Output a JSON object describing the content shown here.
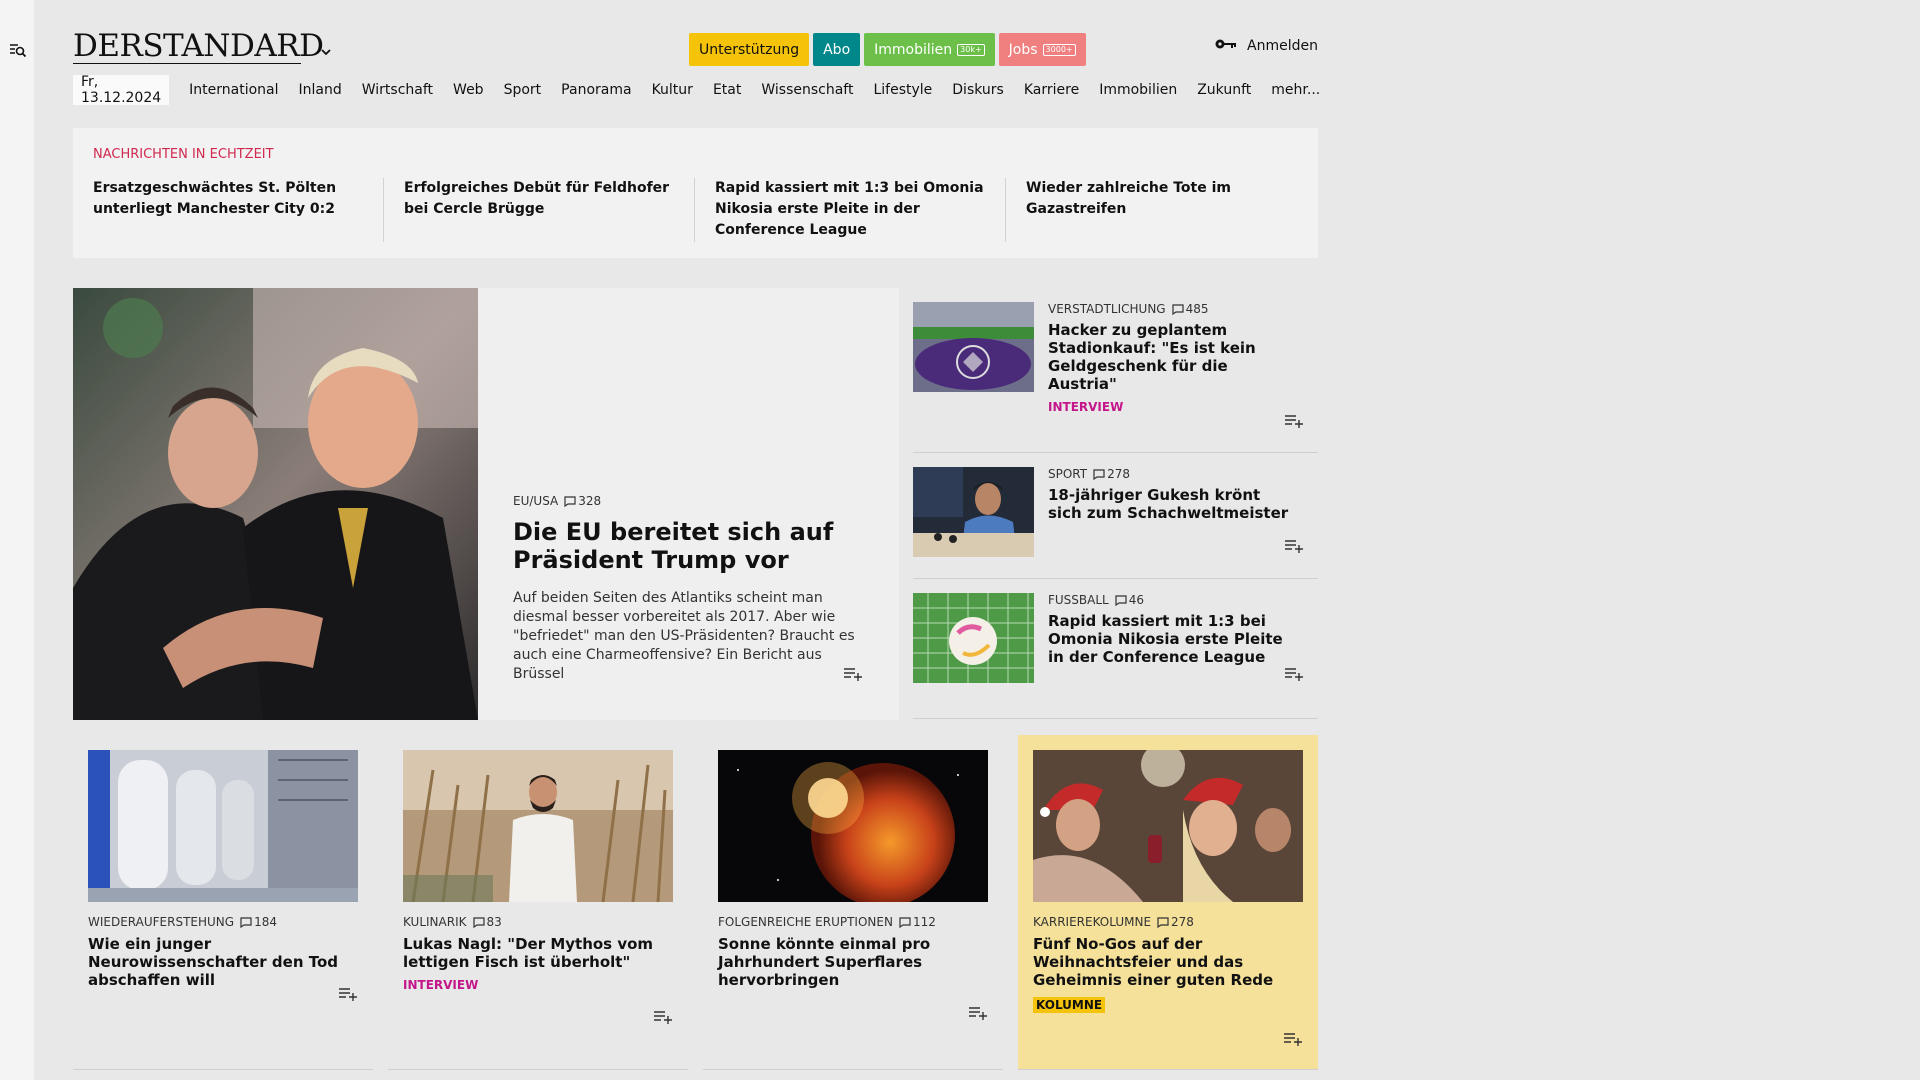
{
  "header": {
    "logo_text": "DERSTANDARD",
    "promo": [
      {
        "label": "Unterstützung",
        "badge": "",
        "bg": "#f5c40a",
        "fg": "#111111"
      },
      {
        "label": "Abo",
        "badge": "",
        "bg": "#00878a",
        "fg": "#ffffff"
      },
      {
        "label": "Immobilien",
        "badge": "30k+",
        "bg": "#6cc04a",
        "fg": "#ffffff"
      },
      {
        "label": "Jobs",
        "badge": "3000+",
        "bg": "#f08080",
        "fg": "#ffffff"
      }
    ],
    "login_label": "Anmelden"
  },
  "nav": {
    "date": "Fr, 13.12.2024",
    "items": [
      "International",
      "Inland",
      "Wirtschaft",
      "Web",
      "Sport",
      "Panorama",
      "Kultur",
      "Etat",
      "Wissenschaft",
      "Lifestyle",
      "Diskurs",
      "Karriere",
      "Immobilien",
      "Zukunft",
      "mehr..."
    ]
  },
  "ticker": {
    "label": "NACHRICHTEN IN ECHTZEIT",
    "items": [
      "Ersatzgeschwächtes St. Pölten unter­liegt Manchester City 0:2",
      "Erfolgreiches Debüt für Feldhofer bei Cercle Brügge",
      "Rapid kassiert mit 1:3 bei Omonia Ni­kosia erste Pleite in der Conference League",
      "Wieder zahlreiche Tote im Gazastreifen"
    ]
  },
  "hero": {
    "kicker": "EU/USA",
    "comments": "328",
    "title": "Die EU bereitet sich auf Präsident Trump vor",
    "lead": "Auf beiden Seiten des Atlantiks scheint man diesmal besser vorbereitet als 2017. Aber wie \"befriedet\" man den US-Präsidenten? Braucht es auch eine Charmeoffensive? Ein Bericht aus Brüssel"
  },
  "side": [
    {
      "kicker": "VERSTADTLICHUNG",
      "comments": "485",
      "title": "Hacker zu geplantem Stadionkauf: \"Es ist kein Geldgeschenk für die Austria\"",
      "tag": "INTERVIEW"
    },
    {
      "kicker": "SPORT",
      "comments": "278",
      "title": "18-jähriger Gukesh krönt sich zum Schachweltmeister",
      "tag": ""
    },
    {
      "kicker": "FUSSBALL",
      "comments": "46",
      "title": "Rapid kassiert mit 1:3 bei Omonia Nikosia erste Pleite in der Conference League",
      "tag": ""
    }
  ],
  "cards": [
    {
      "kicker": "WIEDERAUFERSTEHUNG",
      "comments": "184",
      "title": "Wie ein junger Neurowissenschaf­ter den Tod abschaffen will",
      "tag": ""
    },
    {
      "kicker": "KULINARIK",
      "comments": "83",
      "title": "Lukas Nagl: \"Der Mythos vom lettigen Fisch ist überholt\"",
      "tag": "INTERVIEW"
    },
    {
      "kicker": "FOLGENREICHE ERUPTIONEN",
      "comments": "112",
      "title": "Sonne könnte einmal pro Jahrhundert Superflares hervorbringen",
      "tag": ""
    },
    {
      "kicker": "KARRIEREKOLUMNE",
      "comments": "278",
      "title": "Fünf No-Gos auf der Weihnachts­feier und das Geheimnis einer guten Rede",
      "tag": "KOLUMNE"
    }
  ],
  "colors": {
    "accent_red": "#d0294f",
    "interview_magenta": "#c4168a",
    "kolumne_yellow": "#f5c40a",
    "highlight_card": "#f5e19a"
  },
  "icons": {
    "menu": "search-menu-icon",
    "login": "key-icon",
    "comment": "comment-bubble-icon",
    "add": "add-to-list-icon"
  }
}
